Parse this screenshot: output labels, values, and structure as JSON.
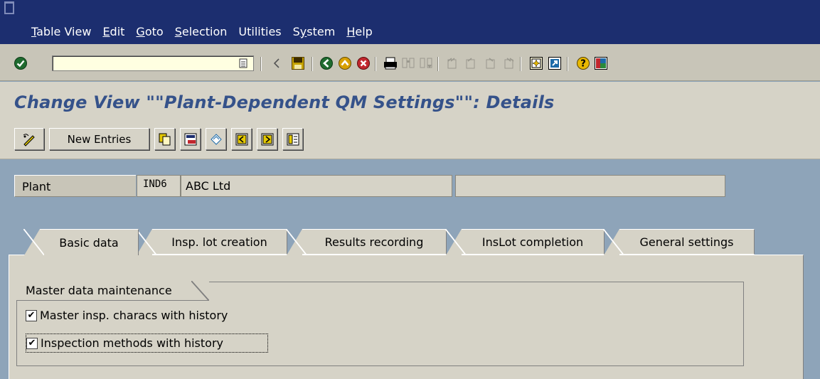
{
  "menu": {
    "items": [
      {
        "label": "Table View",
        "hotkey_index": 0
      },
      {
        "label": "Edit",
        "hotkey_index": 0
      },
      {
        "label": "Goto",
        "hotkey_index": 0
      },
      {
        "label": "Selection",
        "hotkey_index": 0
      },
      {
        "label": "Utilities",
        "hotkey_index": -1
      },
      {
        "label": "System",
        "hotkey_index": 1
      },
      {
        "label": "Help",
        "hotkey_index": 0
      }
    ]
  },
  "toolbar": {
    "command_field": {
      "value": "",
      "placeholder": ""
    },
    "icons": [
      "enter-icon",
      "command-field-dropdown-icon",
      "back-arrow-icon",
      "save-icon",
      "back-icon",
      "exit-icon",
      "cancel-icon",
      "print-icon",
      "find-icon",
      "find-next-icon",
      "first-page-icon",
      "previous-page-icon",
      "next-page-icon",
      "last-page-icon",
      "create-session-icon",
      "shortcut-icon",
      "help-icon",
      "layout-menu-icon"
    ]
  },
  "title": "Change View \"\"Plant-Dependent QM Settings\"\": Details",
  "app_toolbar": {
    "new_entries_label": "New Entries",
    "icons": [
      "display-change-icon",
      "copy-as-icon",
      "delete-icon",
      "undo-change-icon",
      "previous-entry-icon",
      "next-entry-icon",
      "select-all-icon"
    ]
  },
  "header": {
    "plant_label": "Plant",
    "plant_code": "IND6",
    "plant_name": "ABC Ltd",
    "extra_value": ""
  },
  "tabs": [
    {
      "label": "Basic data",
      "active": true
    },
    {
      "label": "Insp. lot creation",
      "active": false
    },
    {
      "label": "Results recording",
      "active": false
    },
    {
      "label": "InsLot completion",
      "active": false
    },
    {
      "label": "General settings",
      "active": false
    }
  ],
  "group": {
    "title": "Master data maintenance",
    "checkboxes": [
      {
        "label": "Master insp. characs with history",
        "checked": true
      },
      {
        "label": "Inspection methods with history",
        "checked": true
      }
    ]
  },
  "colors": {
    "menubar_bg": "#1c2e6f",
    "title_color": "#35528a",
    "background": "#8ea4b9",
    "panel": "#d6d3c7"
  }
}
